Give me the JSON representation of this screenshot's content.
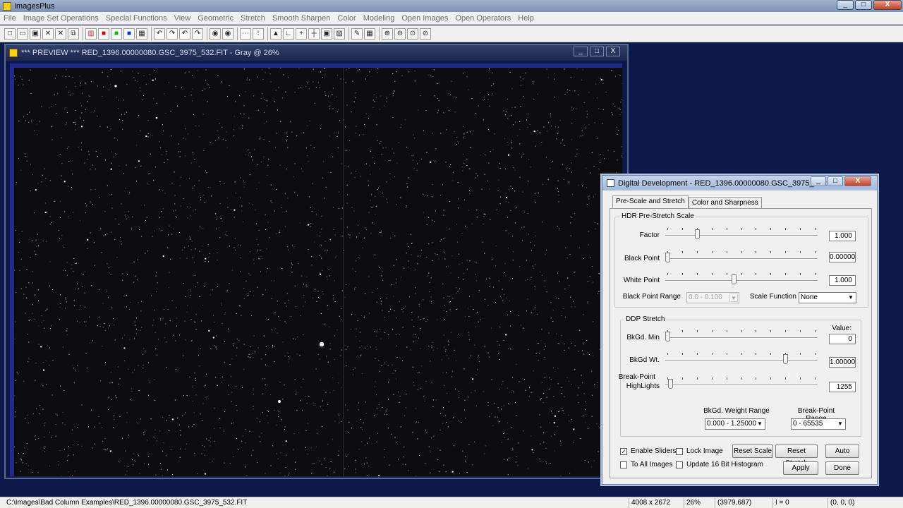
{
  "app": {
    "title": "ImagesPlus"
  },
  "window_controls": {
    "minimize": "_",
    "maximize": "□",
    "close": "X"
  },
  "menu": [
    "File",
    "Image Set Operations",
    "Special Functions",
    "View",
    "Geometric",
    "Stretch",
    "Smooth Sharpen",
    "Color",
    "Modeling",
    "Open Images",
    "Open Operators",
    "Help"
  ],
  "toolbar": [
    {
      "name": "new-icon",
      "glyph": "□"
    },
    {
      "name": "open-icon",
      "glyph": "▭"
    },
    {
      "name": "save-icon",
      "glyph": "▣"
    },
    {
      "name": "close-image-icon",
      "glyph": "✕"
    },
    {
      "name": "close-all-icon",
      "glyph": "✕"
    },
    {
      "name": "copy-icon",
      "glyph": "⧉"
    },
    {
      "name": "rgb-icon",
      "glyph": "▥"
    },
    {
      "name": "red-channel-icon",
      "glyph": "■"
    },
    {
      "name": "green-channel-icon",
      "glyph": "■"
    },
    {
      "name": "blue-channel-icon",
      "glyph": "■"
    },
    {
      "name": "grid-icon",
      "glyph": "▦"
    },
    {
      "name": "undo-icon",
      "glyph": "↶"
    },
    {
      "name": "redo-disabled-icon",
      "glyph": "↷"
    },
    {
      "name": "undo-all-icon",
      "glyph": "↶"
    },
    {
      "name": "redo-all-icon",
      "glyph": "↷"
    },
    {
      "name": "target-icon",
      "glyph": "◉"
    },
    {
      "name": "target-red-icon",
      "glyph": "◉"
    },
    {
      "name": "dots-icon",
      "glyph": "⋯"
    },
    {
      "name": "points-icon",
      "glyph": "⁝"
    },
    {
      "name": "histogram-icon",
      "glyph": "▲"
    },
    {
      "name": "axes-icon",
      "glyph": "∟"
    },
    {
      "name": "add-icon",
      "glyph": "+"
    },
    {
      "name": "crosshair-icon",
      "glyph": "┼"
    },
    {
      "name": "frame-icon",
      "glyph": "▣"
    },
    {
      "name": "image-icon",
      "glyph": "▨"
    },
    {
      "name": "pencil-icon",
      "glyph": "✎"
    },
    {
      "name": "table-icon",
      "glyph": "▦"
    },
    {
      "name": "zoom-in-icon",
      "glyph": "⊕"
    },
    {
      "name": "zoom-out-icon",
      "glyph": "⊖"
    },
    {
      "name": "zoom-fit-icon",
      "glyph": "⊙"
    },
    {
      "name": "zoom-actual-icon",
      "glyph": "⊘"
    }
  ],
  "preview": {
    "title": "*** PREVIEW *** RED_1396.00000080.GSC_3975_532.FIT - Gray @ 26%"
  },
  "dialog": {
    "title": "Digital Development - RED_1396.00000080.GSC_3975_532.FIT",
    "tabs": [
      "Pre-Scale and Stretch",
      "Color and Sharpness"
    ],
    "hdr": {
      "group_label": "HDR Pre-Stretch Scale",
      "factor_label": "Factor",
      "factor_value": "1.000",
      "factor_pos": 0.2,
      "black_point_label": "Black Point",
      "black_point_value": "0.00000",
      "black_point_pos": 0.0,
      "white_point_label": "White Point",
      "white_point_value": "1.000",
      "white_point_pos": 0.45,
      "black_point_range_label": "Black Point Range",
      "black_point_range_value": "0.0 - 0.100",
      "scale_function_label": "Scale Function",
      "scale_function_value": "None"
    },
    "ddp": {
      "group_label": "DDP Stretch",
      "value_header": "Value:",
      "bkgd_min_label": "BkGd. Min",
      "bkgd_min_value": "0",
      "bkgd_min_pos": 0.0,
      "bkgd_wt_label": "BkGd Wt.",
      "bkgd_wt_value": "1.00000",
      "bkgd_wt_pos": 0.8,
      "break_point_label_1": "Break-Point",
      "break_point_label_2": "HighLights",
      "break_point_value": "1255",
      "break_point_pos": 0.02,
      "bkgd_weight_range_label": "BkGd. Weight Range",
      "bkgd_weight_range_value": "0.000 - 1.25000",
      "break_point_range_label": "Break-Point Range",
      "break_point_range_value": "0 - 65535"
    },
    "checkboxes": {
      "enable_sliders": "Enable Sliders",
      "enable_sliders_checked": "✓",
      "lock_image": "Lock Image",
      "to_all_images": "To All Images",
      "update_16bit": "Update 16 Bit Histogram"
    },
    "buttons": {
      "reset_scale": "Reset Scale",
      "reset_stretch": "Reset Stretch",
      "auto": "Auto",
      "apply": "Apply",
      "done": "Done"
    }
  },
  "statusbar": {
    "path": "C:\\Images\\Bad Column Examples\\RED_1396.00000080.GSC_3975_532.FIT",
    "dimensions": "4008 x 2672",
    "zoom": "26%",
    "coords": "(3979,687)",
    "intensity": "I = 0",
    "rgb": "(0, 0, 0)"
  }
}
